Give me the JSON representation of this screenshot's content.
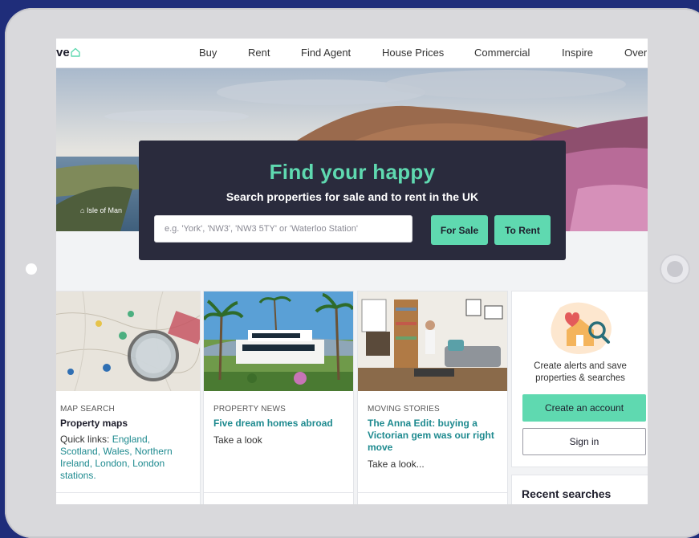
{
  "brand": {
    "logo_text": "ve",
    "accent": "#5fd9b0",
    "dark": "#2a2b3d",
    "link": "#1e8a8f"
  },
  "nav": {
    "items": [
      "Buy",
      "Rent",
      "Find Agent",
      "House Prices",
      "Commercial",
      "Inspire",
      "Over"
    ]
  },
  "hero": {
    "caption": "Isle of Man",
    "title": "Find your happy",
    "subtitle": "Search properties for sale and to rent in the UK",
    "search_placeholder": "e.g. 'York', 'NW3', 'NW3 5TY' or 'Waterloo Station'",
    "for_sale_label": "For Sale",
    "to_rent_label": "To Rent"
  },
  "cards": [
    {
      "eyebrow": "MAP SEARCH",
      "title": "Property maps",
      "quick_links_label": "Quick links: ",
      "quick_links": "England, Scotland, Wales, Northern Ireland, London, London stations."
    },
    {
      "eyebrow": "PROPERTY NEWS",
      "title": "Five dream homes abroad",
      "body": "Take a look"
    },
    {
      "eyebrow": "MOVING STORIES",
      "title": "The Anna Edit: buying a Victorian gem was our right move",
      "body": "Take a look..."
    }
  ],
  "side": {
    "text_line1": "Create alerts and save",
    "text_line2": "properties & searches",
    "create_account_label": "Create an account",
    "sign_in_label": "Sign in"
  },
  "recent": {
    "title": "Recent searches"
  }
}
